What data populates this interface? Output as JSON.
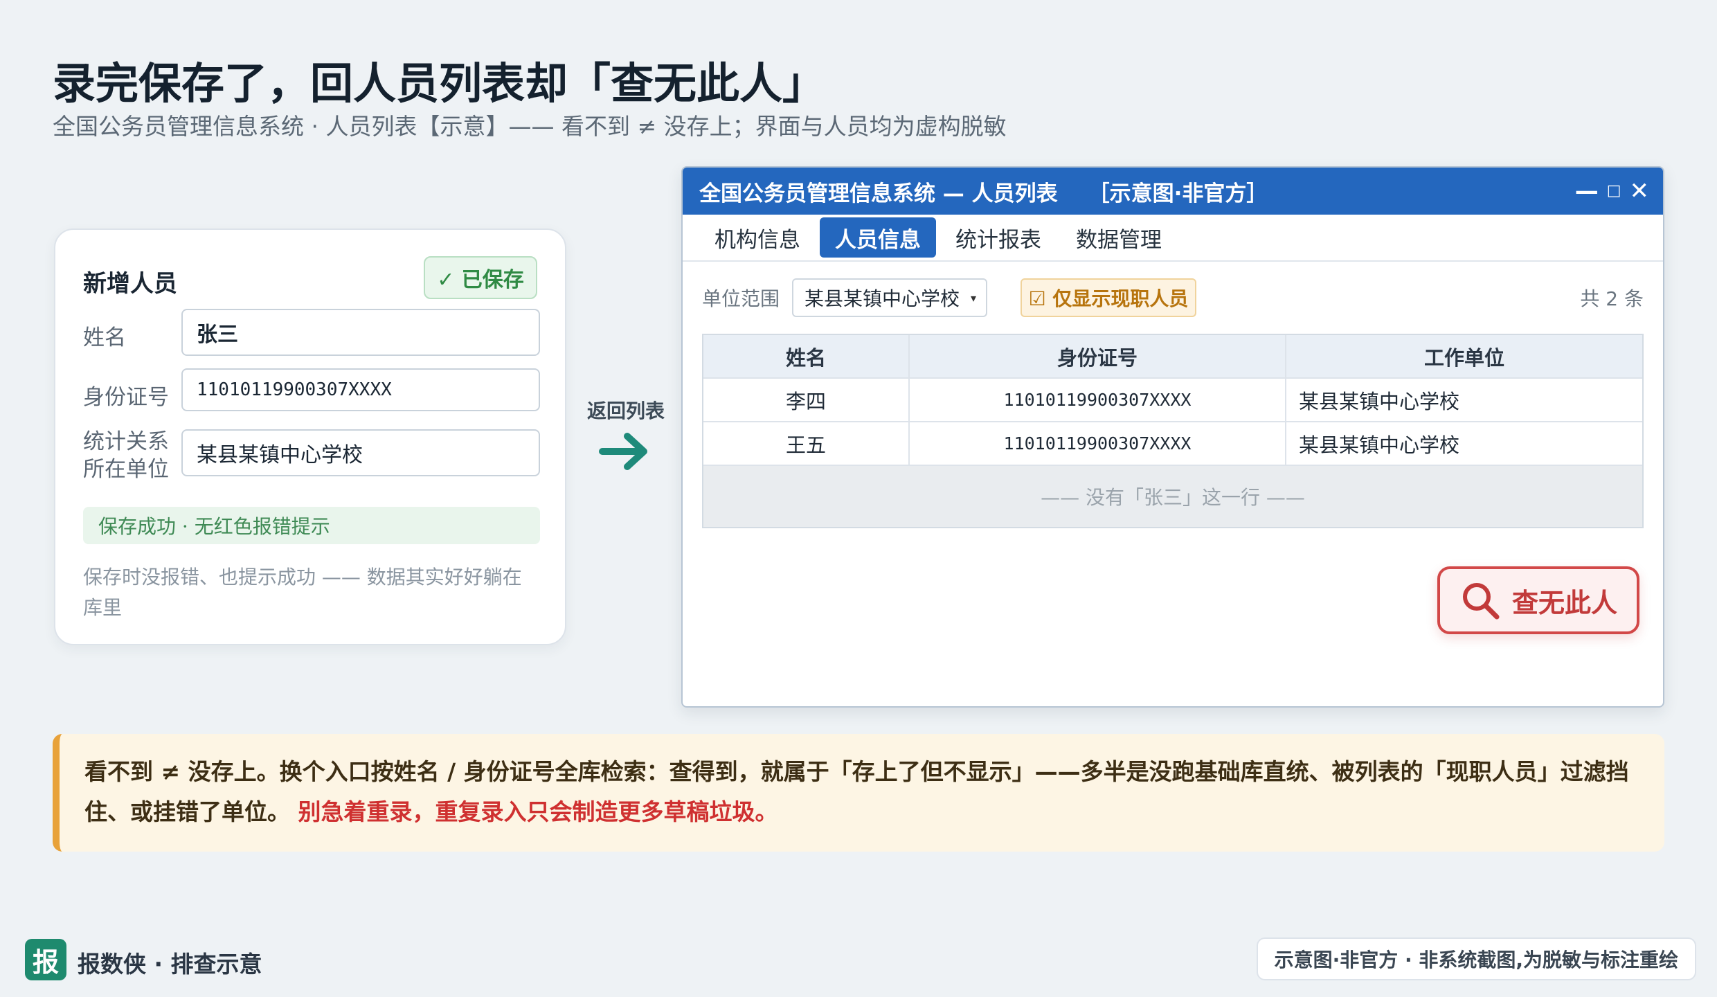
{
  "header": {
    "title": "录完保存了，回人员列表却「查无此人」",
    "subtitle": "全国公务员管理信息系统 · 人员列表【示意】—— 看不到 ≠ 没存上；界面与人员均为虚构脱敏"
  },
  "form_card": {
    "title": "新增人员",
    "saved_badge": "✓ 已保存",
    "fields": [
      {
        "label": "姓名",
        "value": "张三"
      },
      {
        "label": "身份证号",
        "value": "11010119900307XXXX"
      },
      {
        "label_line1": "统计关系",
        "label_line2": "所在单位",
        "value": "某县某镇中心学校"
      }
    ],
    "success_bar": "保存成功 · 无红色报错提示",
    "note": "保存时没报错、也提示成功 —— 数据其实好好躺在库里"
  },
  "arrow": {
    "label": "返回列表"
  },
  "window": {
    "title": "全国公务员管理信息系统 — 人员列表",
    "tag": "［示意图·非官方］",
    "controls": {
      "minimize": "—",
      "maximize": "□",
      "close": "✕"
    },
    "tabs": [
      {
        "label": "机构信息",
        "active": false
      },
      {
        "label": "人员信息",
        "active": true
      },
      {
        "label": "统计报表",
        "active": false
      },
      {
        "label": "数据管理",
        "active": false
      }
    ],
    "filter": {
      "scope_label": "单位范围",
      "scope_value": "某县某镇中心学校",
      "caret": "▾",
      "checkbox_label": "☑ 仅显示现职人员",
      "count": "共 2 条"
    },
    "table": {
      "headers": [
        "姓名",
        "身份证号",
        "工作单位"
      ],
      "rows": [
        [
          "李四",
          "11010119900307XXXX",
          "某县某镇中心学校"
        ],
        [
          "王五",
          "11010119900307XXXX",
          "某县某镇中心学校"
        ]
      ],
      "empty_note": "—— 没有「张三」这一行 ——"
    },
    "stamp": {
      "text": "查无此人",
      "icon": "search-icon"
    }
  },
  "callout": {
    "text": "看不到 ≠ 没存上。换个入口按姓名 / 身份证号全库检索：查得到，就属于「存上了但不显示」——多半是没跑基础库直统、被列表的「现职人员」过滤挡住、或挂错了单位。",
    "warning": "别急着重录，重复录入只会制造更多草稿垃圾。"
  },
  "footer": {
    "logo_char": "报",
    "brand": "报数侠 · 排查示意",
    "disclaimer": "示意图·非官方 · 非系统截图,为脱敏与标注重绘"
  },
  "colors": {
    "accent_blue": "#2467be",
    "success_green": "#2f8a44",
    "warn_red": "#c23a3a",
    "teal_arrow": "#1e8a7a",
    "callout_border": "#e8a23a"
  }
}
